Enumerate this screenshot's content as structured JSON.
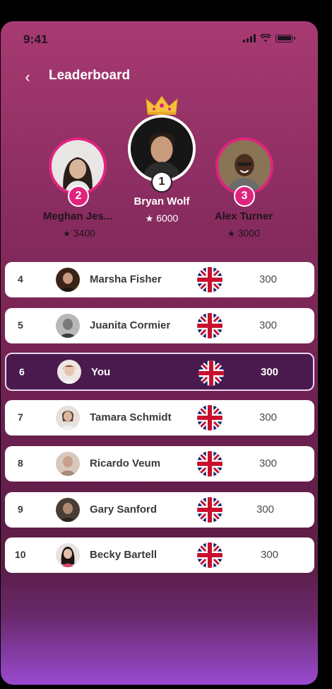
{
  "status": {
    "time": "9:41"
  },
  "header": {
    "title": "Leaderboard",
    "back_icon": "chevron-left-icon"
  },
  "podium": [
    {
      "rank": "2",
      "name": "Meghan Jes...",
      "score": "3400",
      "badge_color": "#e0247d"
    },
    {
      "rank": "1",
      "name": "Bryan Wolf",
      "score": "6000",
      "badge_color": "#ffffff"
    },
    {
      "rank": "3",
      "name": "Alex Turner",
      "score": "3000",
      "badge_color": "#e0247d"
    }
  ],
  "rows": [
    {
      "rank": "4",
      "name": "Marsha Fisher",
      "score": "300"
    },
    {
      "rank": "5",
      "name": "Juanita Cormier",
      "score": "300"
    },
    {
      "rank": "6",
      "name": "You",
      "score": "300",
      "is_me": true
    },
    {
      "rank": "7",
      "name": "Tamara Schmidt",
      "score": "300"
    },
    {
      "rank": "8",
      "name": "Ricardo Veum",
      "score": "300"
    },
    {
      "rank": "9",
      "name": "Gary Sanford",
      "score": "300"
    },
    {
      "rank": "10",
      "name": "Becky Bartell",
      "score": "300"
    }
  ],
  "colors": {
    "accent": "#e0247d",
    "background_top": "#a83a72",
    "highlight_row": "#4a1a4e"
  }
}
